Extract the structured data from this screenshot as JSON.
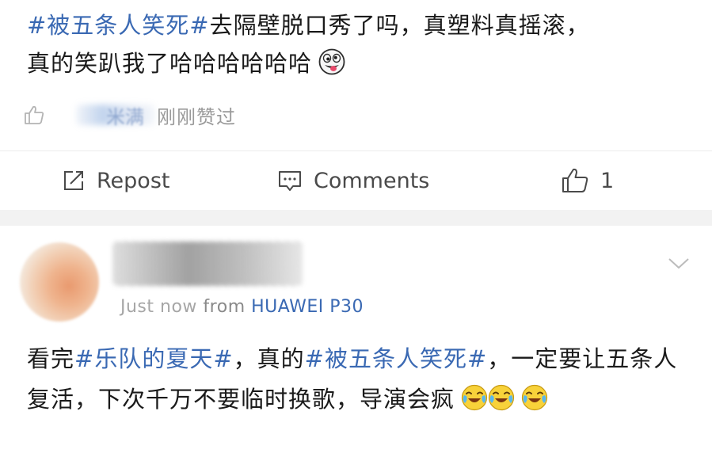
{
  "post": {
    "topic": "#被五条人笑死#",
    "text_after_topic": "去隔壁脱口秀了吗，真塑料真摇滚，",
    "text_line2": "真的笑趴我了哈哈哈哈哈哈",
    "emoji": "crazy-face-emoji",
    "liked_by": {
      "name_visible": "米满",
      "suffix": "刚刚赞过"
    }
  },
  "actions": {
    "repost_label": "Repost",
    "comments_label": "Comments",
    "like_count": "1"
  },
  "comment": {
    "timestamp": "Just now",
    "from_label": "from",
    "device": "HUAWEI P30",
    "parts": [
      {
        "text": "看完",
        "type": "plain"
      },
      {
        "text": "#乐队的夏天#",
        "type": "topic"
      },
      {
        "text": "，真的",
        "type": "plain"
      },
      {
        "text": "#被五条人笑死#",
        "type": "topic"
      },
      {
        "text": "，一定要让五条人复活，下次千万不要临时换歌，导演会疯",
        "type": "plain"
      }
    ],
    "emojis": [
      "laughing-crying-emoji",
      "laughing-crying-emoji",
      "laughing-crying-emoji"
    ]
  },
  "colors": {
    "topic_blue": "#3a69b3",
    "text": "#1a1a1a",
    "muted": "#9a9a9a",
    "separator": "#f2f2f2"
  }
}
